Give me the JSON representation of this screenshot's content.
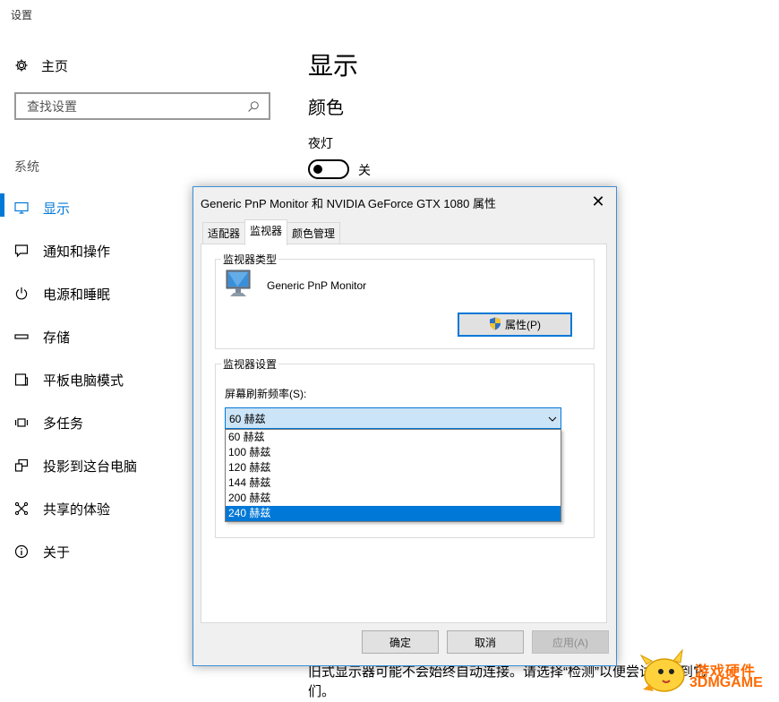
{
  "window": {
    "title": "设置"
  },
  "sidebar": {
    "home_label": "主页",
    "search_placeholder": "查找设置",
    "section_label": "系统",
    "items": [
      {
        "label": "显示",
        "icon": "monitor-icon",
        "active": true
      },
      {
        "label": "通知和操作",
        "icon": "message-icon"
      },
      {
        "label": "电源和睡眠",
        "icon": "power-icon"
      },
      {
        "label": "存储",
        "icon": "storage-icon"
      },
      {
        "label": "平板电脑模式",
        "icon": "tablet-icon"
      },
      {
        "label": "多任务",
        "icon": "multitask-icon"
      },
      {
        "label": "投影到这台电脑",
        "icon": "project-icon"
      },
      {
        "label": "共享的体验",
        "icon": "share-icon"
      },
      {
        "label": "关于",
        "icon": "info-icon"
      }
    ]
  },
  "main": {
    "title": "显示",
    "color_heading": "颜色",
    "night_light_label": "夜灯",
    "night_light_state": "关",
    "bottom_text": "旧式显示器可能不会始终自动连接。请选择“检测”以便尝试连接到它们。"
  },
  "dialog": {
    "title": "Generic PnP Monitor 和 NVIDIA GeForce GTX 1080 属性",
    "tabs": [
      "适配器",
      "监视器",
      "颜色管理"
    ],
    "active_tab": "监视器",
    "monitor_type_group": "监视器类型",
    "monitor_name": "Generic PnP Monitor",
    "properties_button": "属性(P)",
    "monitor_settings_group": "监视器设置",
    "refresh_label": "屏幕刷新频率(S):",
    "refresh_selected": "60 赫兹",
    "refresh_options": [
      "60 赫兹",
      "100 赫兹",
      "120 赫兹",
      "144 赫兹",
      "200 赫兹",
      "240 赫兹"
    ],
    "highlighted_option": "240 赫兹",
    "ok_button": "确定",
    "cancel_button": "取消",
    "apply_button": "应用(A)"
  },
  "watermark": {
    "line1": "游戏硬件",
    "line2": "3DMGAME"
  },
  "colors": {
    "accent": "#0078d7",
    "watermark": "#ff6a00"
  }
}
